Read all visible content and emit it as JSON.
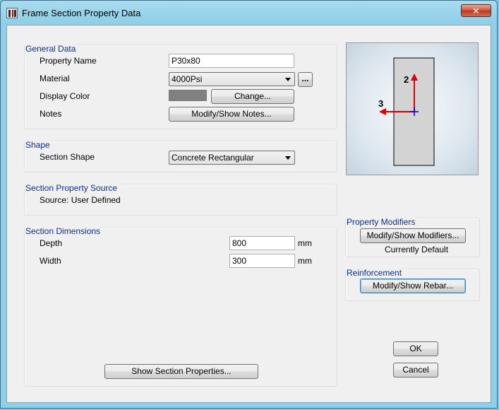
{
  "window": {
    "title": "Frame Section Property Data",
    "close_glyph": "✕"
  },
  "general": {
    "title": "General Data",
    "property_name_label": "Property Name",
    "property_name_value": "P30x80",
    "material_label": "Material",
    "material_value": "4000Psi",
    "material_more_label": "...",
    "display_color_label": "Display Color",
    "display_color_swatch": "#808080",
    "change_button": "Change...",
    "notes_label": "Notes",
    "notes_button": "Modify/Show Notes..."
  },
  "shape": {
    "title": "Shape",
    "section_shape_label": "Section Shape",
    "section_shape_value": "Concrete Rectangular"
  },
  "source": {
    "title": "Section Property Source",
    "source_text": "Source:  User Defined"
  },
  "dimensions": {
    "title": "Section Dimensions",
    "depth_label": "Depth",
    "depth_value": "800",
    "depth_unit": "mm",
    "width_label": "Width",
    "width_value": "300",
    "width_unit": "mm",
    "show_properties_button": "Show Section Properties..."
  },
  "preview": {
    "axis2_label": "2",
    "axis3_label": "3",
    "axis_color": "#dd0000",
    "centroid_color": "#0000cc"
  },
  "modifiers": {
    "title": "Property Modifiers",
    "button": "Modify/Show Modifiers...",
    "status": "Currently Default"
  },
  "reinforcement": {
    "title": "Reinforcement",
    "button": "Modify/Show Rebar..."
  },
  "actions": {
    "ok": "OK",
    "cancel": "Cancel"
  }
}
